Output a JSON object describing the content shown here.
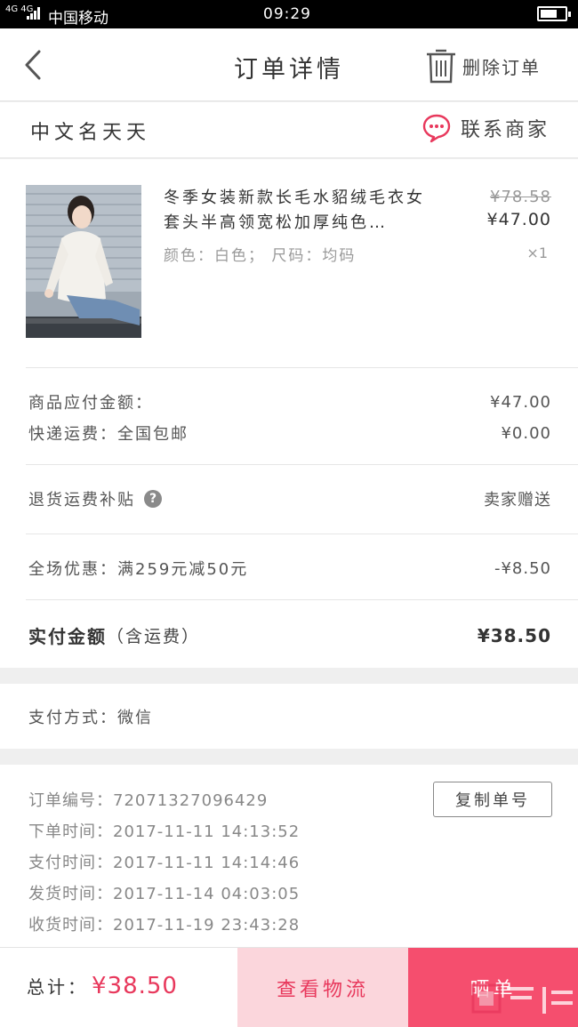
{
  "status_bar": {
    "network": "4G 4G",
    "carrier": "中国移动",
    "time": "09:29"
  },
  "header": {
    "back_icon": "chevron-left-icon",
    "title": "订单详情",
    "delete_icon": "trash-icon",
    "delete_label": "删除订单"
  },
  "shop": {
    "name": "中文名天天",
    "contact_icon": "chat-bubble-icon",
    "contact_label": "联系商家"
  },
  "product": {
    "title": "冬季女装新款长毛水貂绒毛衣女套头半高领宽松加厚纯色…",
    "spec": "颜色：白色； 尺码：均码",
    "original_price": "¥78.58",
    "price": "¥47.00",
    "quantity": "×1"
  },
  "summary": {
    "goods_label": "商品应付金额：",
    "goods_value": "¥47.00",
    "shipping_label": "快递运费：全国包邮",
    "shipping_value": "¥0.00",
    "return_label": "退货运费补贴",
    "return_value": "卖家赠送",
    "discount_label": "全场优惠：满259元减50元",
    "discount_value": "-¥8.50",
    "total_label": "实付金额",
    "total_sub": "（含运费）",
    "total_value": "¥38.50"
  },
  "payment": {
    "method": "支付方式：微信"
  },
  "order_info": {
    "order_no": "订单编号：72071327096429",
    "created": "下单时间：2017-11-11  14:13:52",
    "paid": "支付时间：2017-11-11  14:14:46",
    "shipped": "发货时间：2017-11-14  04:03:05",
    "received": "收货时间：2017-11-19  23:43:28",
    "copy_label": "复制单号"
  },
  "footer": {
    "total_label": "总计：",
    "total_value": "¥38.50",
    "logistics_label": "查看物流",
    "confirm_label": "晒单"
  },
  "colors": {
    "accent": "#e8385c",
    "logistics_bg": "#fbd6dc",
    "confirm_bg": "#f54e6e"
  }
}
